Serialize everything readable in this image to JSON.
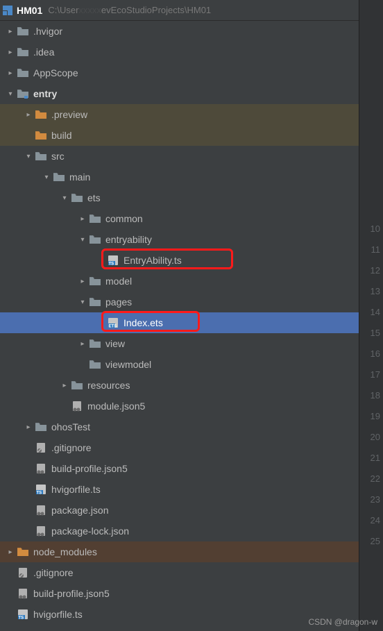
{
  "header": {
    "title": "HM01",
    "path_left": "C:\\User",
    "path_right": "evEcoStudioProjects\\HM01"
  },
  "tree": [
    {
      "indent": 0,
      "chev": "right",
      "icon": "folder-gray",
      "label": ".hvigor"
    },
    {
      "indent": 0,
      "chev": "right",
      "icon": "folder-gray",
      "label": ".idea"
    },
    {
      "indent": 0,
      "chev": "right",
      "icon": "folder-gray",
      "label": "AppScope"
    },
    {
      "indent": 0,
      "chev": "down",
      "icon": "folder-module",
      "label": "entry",
      "bold": true
    },
    {
      "indent": 1,
      "chev": "right",
      "icon": "folder-orange",
      "label": ".preview",
      "hl": "build"
    },
    {
      "indent": 1,
      "chev": "",
      "icon": "folder-orange",
      "label": "build",
      "hl": "build"
    },
    {
      "indent": 1,
      "chev": "down",
      "icon": "folder-gray",
      "label": "src"
    },
    {
      "indent": 2,
      "chev": "down",
      "icon": "folder-gray",
      "label": "main"
    },
    {
      "indent": 3,
      "chev": "down",
      "icon": "folder-gray",
      "label": "ets"
    },
    {
      "indent": 4,
      "chev": "right",
      "icon": "folder-gray",
      "label": "common"
    },
    {
      "indent": 4,
      "chev": "down",
      "icon": "folder-gray",
      "label": "entryability"
    },
    {
      "indent": 5,
      "chev": "",
      "icon": "file-ts",
      "label": "EntryAbility.ts",
      "redbox": true
    },
    {
      "indent": 4,
      "chev": "right",
      "icon": "folder-gray",
      "label": "model"
    },
    {
      "indent": 4,
      "chev": "down",
      "icon": "folder-gray",
      "label": "pages"
    },
    {
      "indent": 5,
      "chev": "",
      "icon": "file-ets",
      "label": "Index.ets",
      "hl": "sel",
      "redbox": true
    },
    {
      "indent": 4,
      "chev": "right",
      "icon": "folder-gray",
      "label": "view"
    },
    {
      "indent": 4,
      "chev": "",
      "icon": "folder-gray",
      "label": "viewmodel"
    },
    {
      "indent": 3,
      "chev": "right",
      "icon": "folder-gray",
      "label": "resources"
    },
    {
      "indent": 3,
      "chev": "",
      "icon": "file-json5",
      "label": "module.json5"
    },
    {
      "indent": 1,
      "chev": "right",
      "icon": "folder-gray",
      "label": "ohosTest"
    },
    {
      "indent": 1,
      "chev": "",
      "icon": "file-gitignore",
      "label": ".gitignore"
    },
    {
      "indent": 1,
      "chev": "",
      "icon": "file-json5",
      "label": "build-profile.json5"
    },
    {
      "indent": 1,
      "chev": "",
      "icon": "file-ts",
      "label": "hvigorfile.ts"
    },
    {
      "indent": 1,
      "chev": "",
      "icon": "file-json",
      "label": "package.json"
    },
    {
      "indent": 1,
      "chev": "",
      "icon": "file-json",
      "label": "package-lock.json"
    },
    {
      "indent": 0,
      "chev": "right",
      "icon": "folder-orange",
      "label": "node_modules",
      "hl": "node"
    },
    {
      "indent": 0,
      "chev": "",
      "icon": "file-gitignore",
      "label": ".gitignore"
    },
    {
      "indent": 0,
      "chev": "",
      "icon": "file-json5",
      "label": "build-profile.json5"
    },
    {
      "indent": 0,
      "chev": "",
      "icon": "file-ts",
      "label": "hvigorfile.ts"
    }
  ],
  "gutter": [
    "10",
    "11",
    "12",
    "13",
    "14",
    "15",
    "16",
    "17",
    "18",
    "19",
    "20",
    "21",
    "22",
    "23",
    "24",
    "25"
  ],
  "watermark": "CSDN @dragon-w"
}
